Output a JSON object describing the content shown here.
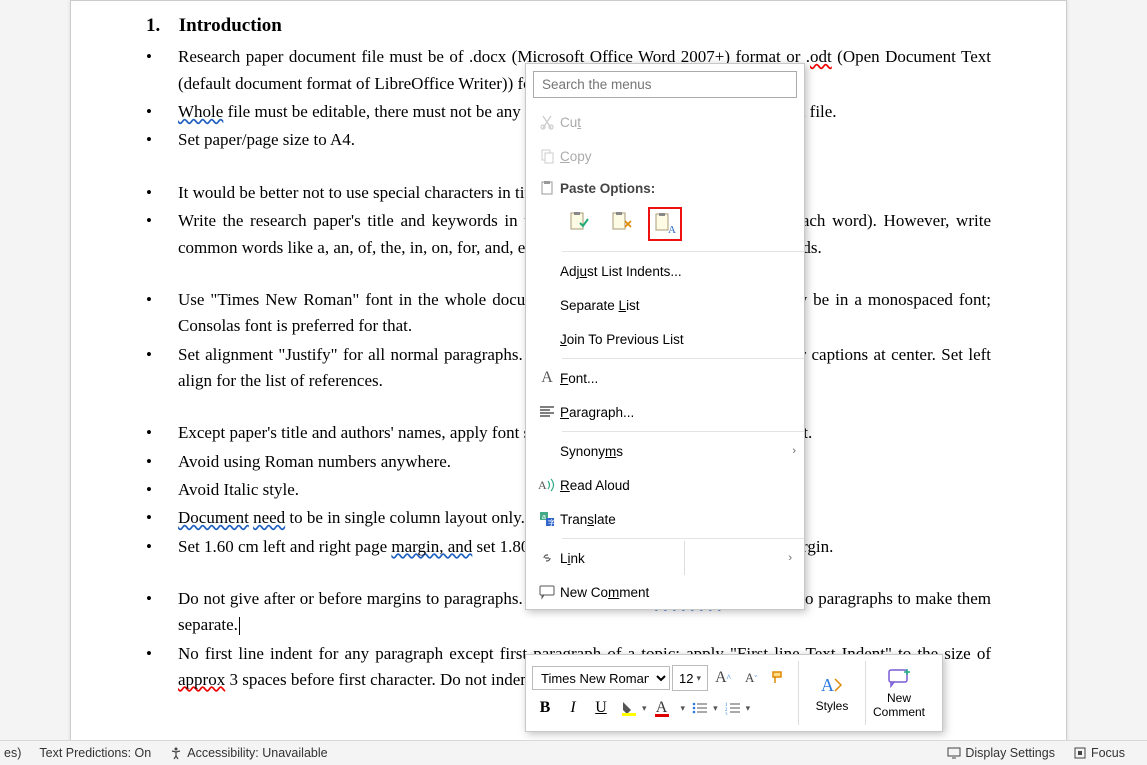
{
  "heading": {
    "number": "1.",
    "title": "Introduction"
  },
  "bullets": {
    "group1": [
      "Research paper document file must be of .docx (Microsoft Office Word 2007+) format or .odt (Open Document Text (default document format of LibreOffice Writer)) format.",
      "Whole file must be editable, there must not be any images of text anywhere in the document file.",
      "Set paper/page size to A4."
    ],
    "group2": [
      "It would be better not to use special characters in title, author names, abstract and keywords.",
      "Write the research paper's title and keywords in title case (capitalize first character of each word). However, write common words like a, an, of, the, in, on, for, and, etc. in lower case in both title and keywords."
    ],
    "group3": [
      "Use \"Times New Roman\" font in the whole document. However, programming code may be in a monospaced font; Consolas font is preferred for that.",
      "Set alignment \"Justify\" for all normal paragraphs. Set all headers, figures, tables, and their captions at center. Set left align for the list of references."
    ],
    "group4": [
      "Except paper's title and authors' names, apply font size 12pt in the whole document's content.",
      "Avoid using Roman numbers anywhere.",
      "Avoid Italic style.",
      "Document need to be in single column layout only.",
      "Set 1.60 cm left and right page margin, and set 1.80 cm top margin, and 1.60 cm bottom margin."
    ],
    "group5": [
      "Do not give after or before margins to paragraphs. Just use an empty paragraph between two paragraphs to make them separate.",
      "No first line indent for any paragraph except first paragraph of a topic; apply \"First line Text Indent\" to the size of approx 3 spaces before first character. Do not indent the bulleted paragraphs."
    ]
  },
  "ctx": {
    "search_placeholder": "Search the menus",
    "cut": "Cut",
    "copy": "Copy",
    "paste_options": "Paste Options:",
    "adjust": "Adjust List Indents...",
    "separate": "Separate List",
    "join": "Join To Previous List",
    "font": "Font...",
    "paragraph": "Paragraph...",
    "synonyms": "Synonyms",
    "read": "Read Aloud",
    "translate": "Translate",
    "link": "Link",
    "comment": "New Comment"
  },
  "mini": {
    "font": "Times New Roman",
    "size": "12",
    "styles": "Styles",
    "newcomment1": "New",
    "newcomment2": "Comment"
  },
  "status": {
    "left1": "es)",
    "predictions": "Text Predictions: On",
    "accessibility": "Accessibility: Unavailable",
    "display": "Display Settings",
    "focus": "Focus"
  }
}
